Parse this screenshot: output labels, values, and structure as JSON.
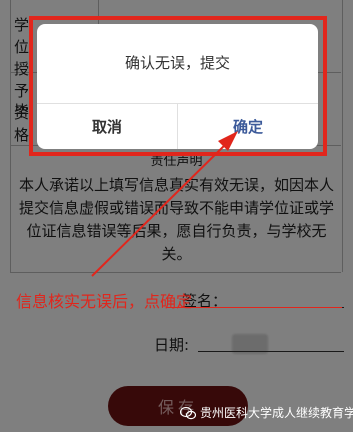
{
  "table": {
    "row1_label": "学位授予资格",
    "row2_label": "毕"
  },
  "statement": {
    "title": "责任声明",
    "body": "本人承诺以上填写信息真实有效无误，如因本人提交信息虚假或错误而导致不能申请学位证或学位证信息错误等后果，愿自行负责，与学校无关。"
  },
  "form": {
    "signature_label": "签名：",
    "date_label": "日期:"
  },
  "save_button": {
    "label": "保存"
  },
  "dialog": {
    "message": "确认无误，提交",
    "cancel_label": "取消",
    "confirm_label": "确定"
  },
  "annotation": {
    "text": "信息核实无误后，点确定",
    "color": "#e1261c"
  },
  "watermark": {
    "icon": "wechat-official-account-icon",
    "text": "贵州医科大学成人继续教育学院"
  }
}
